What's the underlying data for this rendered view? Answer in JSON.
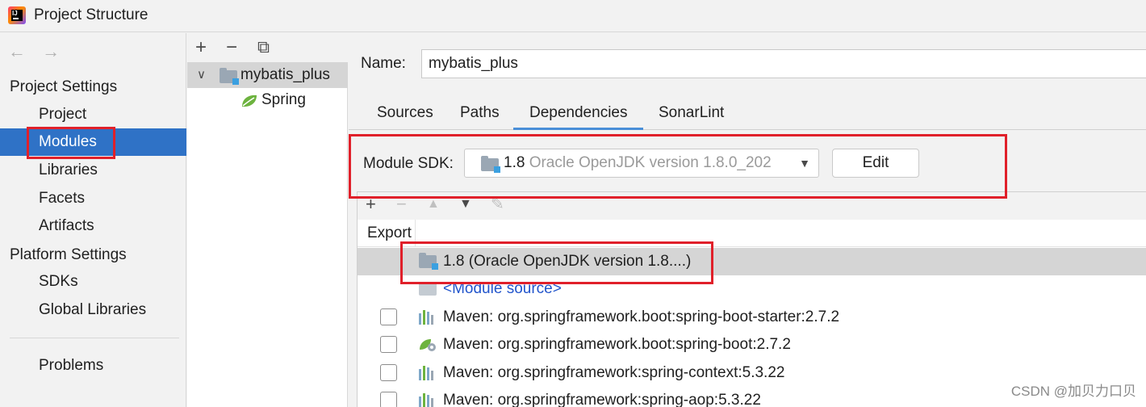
{
  "window": {
    "title": "Project Structure"
  },
  "sidebar": {
    "back_arrow": "←",
    "forward_arrow": "→",
    "project_settings_header": "Project Settings",
    "platform_settings_header": "Platform Settings",
    "items": [
      {
        "label": "Project"
      },
      {
        "label": "Modules"
      },
      {
        "label": "Libraries"
      },
      {
        "label": "Facets"
      },
      {
        "label": "Artifacts"
      },
      {
        "label": "SDKs"
      },
      {
        "label": "Global Libraries"
      },
      {
        "label": "Problems"
      }
    ],
    "selected": "Modules"
  },
  "tree": {
    "toolbar": {
      "add": "+",
      "remove": "−",
      "copy": "⧉"
    },
    "expand_arrow": "∨",
    "module": "mybatis_plus",
    "facet": "Spring"
  },
  "main": {
    "name_label": "Name:",
    "name_value": "mybatis_plus",
    "tabs": [
      "Sources",
      "Paths",
      "Dependencies",
      "SonarLint"
    ],
    "active_tab": "Dependencies",
    "module_sdk_label": "Module SDK:",
    "sdk_version": "1.8",
    "sdk_detail": "Oracle OpenJDK version 1.8.0_202",
    "dropdown_arrow": "▼",
    "edit_button": "Edit",
    "dep_toolbar": {
      "add": "+",
      "remove": "−",
      "up": "▲",
      "down": "▼",
      "edit": "✎"
    },
    "export_header": "Export",
    "dependencies": [
      {
        "text": "1.8 (Oracle OpenJDK version 1.8....)",
        "kind": "sdk"
      },
      {
        "text": "<Module source>",
        "kind": "source"
      },
      {
        "text": "Maven: org.springframework.boot:spring-boot-starter:2.7.2",
        "kind": "maven"
      },
      {
        "text": "Maven: org.springframework.boot:spring-boot:2.7.2",
        "kind": "spring"
      },
      {
        "text": "Maven: org.springframework:spring-context:5.3.22",
        "kind": "maven"
      },
      {
        "text": "Maven: org.springframework:spring-aop:5.3.22",
        "kind": "maven"
      }
    ]
  },
  "colors": {
    "selection_blue": "#2f72c6",
    "highlight_red": "#e0202a",
    "link_blue": "#2255cc"
  },
  "watermark": "CSDN @加贝力口贝"
}
